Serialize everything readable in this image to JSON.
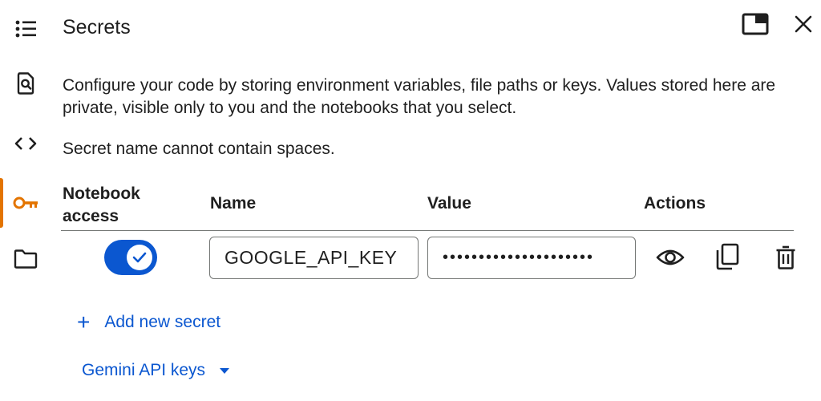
{
  "panel": {
    "title": "Secrets",
    "description": "Configure your code by storing environment variables, file paths or keys. Values stored here are private, visible only to you and the notebooks that you select.",
    "hint": "Secret name cannot contain spaces."
  },
  "rail": {
    "items": [
      {
        "icon": "toc-list-icon",
        "active": false
      },
      {
        "icon": "find-in-page-icon",
        "active": false
      },
      {
        "icon": "code-icon",
        "active": false
      },
      {
        "icon": "key-icon",
        "active": true
      },
      {
        "icon": "folder-icon",
        "active": false
      }
    ],
    "active_color": "#e37400"
  },
  "window_controls": {
    "icons": [
      "open-in-tab-icon",
      "close-icon"
    ]
  },
  "table": {
    "headers": {
      "notebook_access": "Notebook access",
      "name": "Name",
      "value": "Value",
      "actions": "Actions"
    },
    "rows": [
      {
        "notebook_access": true,
        "name": "GOOGLE_API_KEY",
        "value_masked": "•••••••••••••••••••••",
        "actions": [
          "visibility-icon",
          "copy-icon",
          "delete-icon"
        ]
      }
    ]
  },
  "add_secret_label": "Add new secret",
  "gemini_keys_label": "Gemini API keys",
  "colors": {
    "accent_blue": "#0b57d0",
    "text": "#1f1f1f",
    "border": "#747775"
  }
}
